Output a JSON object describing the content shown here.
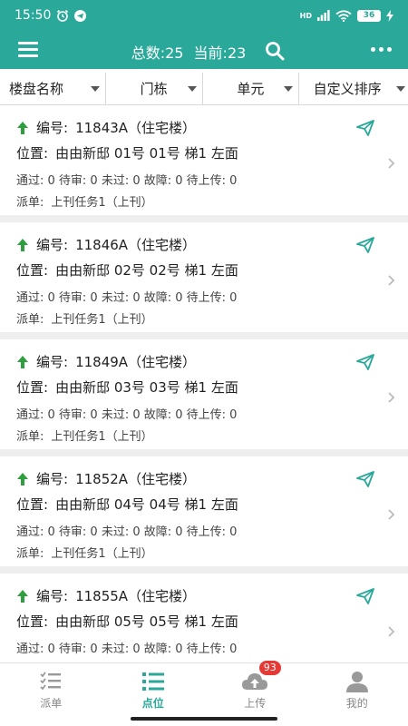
{
  "status_bar": {
    "time": "15:50",
    "signal": "HD",
    "battery": "36"
  },
  "header": {
    "total_label": "总数:",
    "total_value": "25",
    "current_label": "当前:",
    "current_value": "23"
  },
  "filters": [
    {
      "label": "楼盘名称"
    },
    {
      "label": "门栋"
    },
    {
      "label": "单元"
    },
    {
      "label": "自定义排序"
    }
  ],
  "labels": {
    "code": "编号:",
    "location": "位置:",
    "dispatch": "派单:"
  },
  "items": [
    {
      "code": "11843A（住宅楼）",
      "location": "由由新邸 01号 01号 梯1 左面",
      "stats": "通过: 0  待审: 0  未过: 0  故障: 0  待上传: 0",
      "dispatch": "上刊任务1（上刊）"
    },
    {
      "code": "11846A（住宅楼）",
      "location": "由由新邸 02号 02号 梯1 左面",
      "stats": "通过: 0  待审: 0  未过: 0  故障: 0  待上传: 0",
      "dispatch": "上刊任务1（上刊）"
    },
    {
      "code": "11849A（住宅楼）",
      "location": "由由新邸 03号 03号 梯1 左面",
      "stats": "通过: 0  待审: 0  未过: 0  故障: 0  待上传: 0",
      "dispatch": "上刊任务1（上刊）"
    },
    {
      "code": "11852A（住宅楼）",
      "location": "由由新邸 04号 04号 梯1 左面",
      "stats": "通过: 0  待审: 0  未过: 0  故障: 0  待上传: 0",
      "dispatch": "上刊任务1（上刊）"
    },
    {
      "code": "11855A（住宅楼）",
      "location": "由由新邸 05号 05号 梯1 左面",
      "stats": "通过: 0  待审: 0  未过: 0  故障: 0  待上传: 0",
      "dispatch": ""
    }
  ],
  "nav": {
    "tabs": [
      {
        "label": "派单",
        "icon": "checklist-icon"
      },
      {
        "label": "点位",
        "icon": "list-icon"
      },
      {
        "label": "上传",
        "icon": "cloud-upload-icon",
        "badge": "93"
      },
      {
        "label": "我的",
        "icon": "person-icon"
      }
    ],
    "active_index": 1
  },
  "colors": {
    "primary": "#2aa89a",
    "arrow_green": "#2e9e3e",
    "badge_red": "#e53935"
  }
}
